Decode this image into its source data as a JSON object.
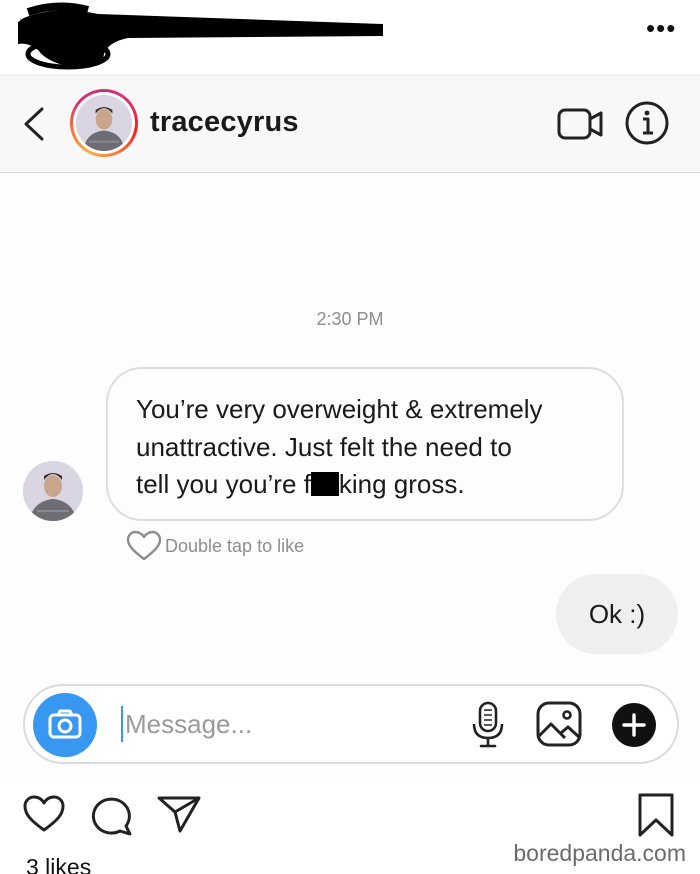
{
  "post": {
    "more_icon": "more-dots-icon",
    "likes": "3 likes",
    "watermark": "boredpanda.com"
  },
  "header": {
    "username": "tracecyrus",
    "back_icon": "chevron-left-icon",
    "video_icon": "video-camera-icon",
    "info_icon": "info-icon"
  },
  "chat": {
    "timestamp": "2:30 PM",
    "incoming": {
      "line1": "You’re very overweight & extremely",
      "line2": "unattractive. Just felt the need to",
      "line3_before": "tell you you’re f",
      "line3_after": "king gross."
    },
    "like_hint": "Double tap to like",
    "outgoing": "Ok :)"
  },
  "composer": {
    "placeholder": "Message...",
    "value": ""
  },
  "colors": {
    "accent": "#3897f0",
    "bubble_out": "#efefef",
    "meta_text": "#8e8e8e"
  }
}
